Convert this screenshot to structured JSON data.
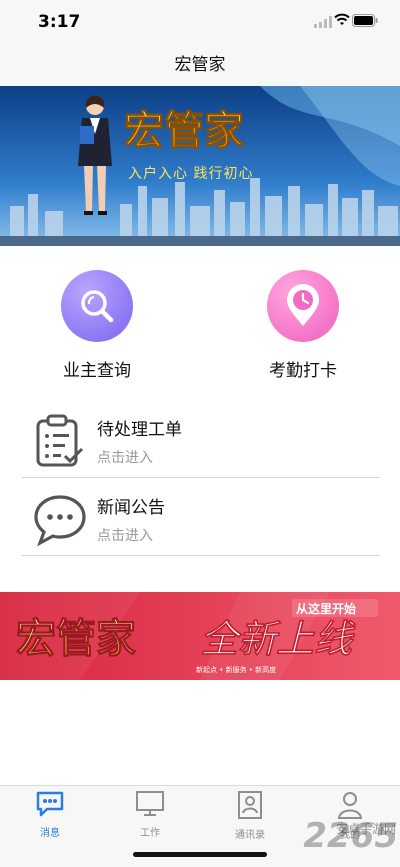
{
  "status_bar": {
    "time": "3:17"
  },
  "nav": {
    "title": "宏管家"
  },
  "banner": {
    "title": "宏管家",
    "slogan": "入户入心 践行初心"
  },
  "quick_actions": [
    {
      "label": "业主查询",
      "icon": "search-icon"
    },
    {
      "label": "考勤打卡",
      "icon": "clock-location-icon"
    }
  ],
  "entries": [
    {
      "title": "待处理工单",
      "subtitle": "点击进入",
      "icon": "clipboard-checklist-icon"
    },
    {
      "title": "新闻公告",
      "subtitle": "点击进入",
      "icon": "chat-bubble-icon"
    }
  ],
  "promo": {
    "brand": "宏管家",
    "headline": "全新上线",
    "tagline": "从这里开始",
    "sub": "新起点 • 新服务 • 新高度"
  },
  "tabs": [
    {
      "label": "消息",
      "icon": "message-icon",
      "active": true
    },
    {
      "label": "工作",
      "icon": "monitor-icon",
      "active": false
    },
    {
      "label": "通讯录",
      "icon": "contacts-icon",
      "active": false
    },
    {
      "label": "我的",
      "icon": "person-icon",
      "active": false
    }
  ],
  "watermark": {
    "main": "2265",
    "sub": "安卓手游网"
  },
  "colors": {
    "accent": "#2a7de1",
    "banner_bg": "#1f5fa8",
    "promo_bg": "#e23a55",
    "purple": "#7a63ee",
    "pink": "#f05fbf"
  }
}
